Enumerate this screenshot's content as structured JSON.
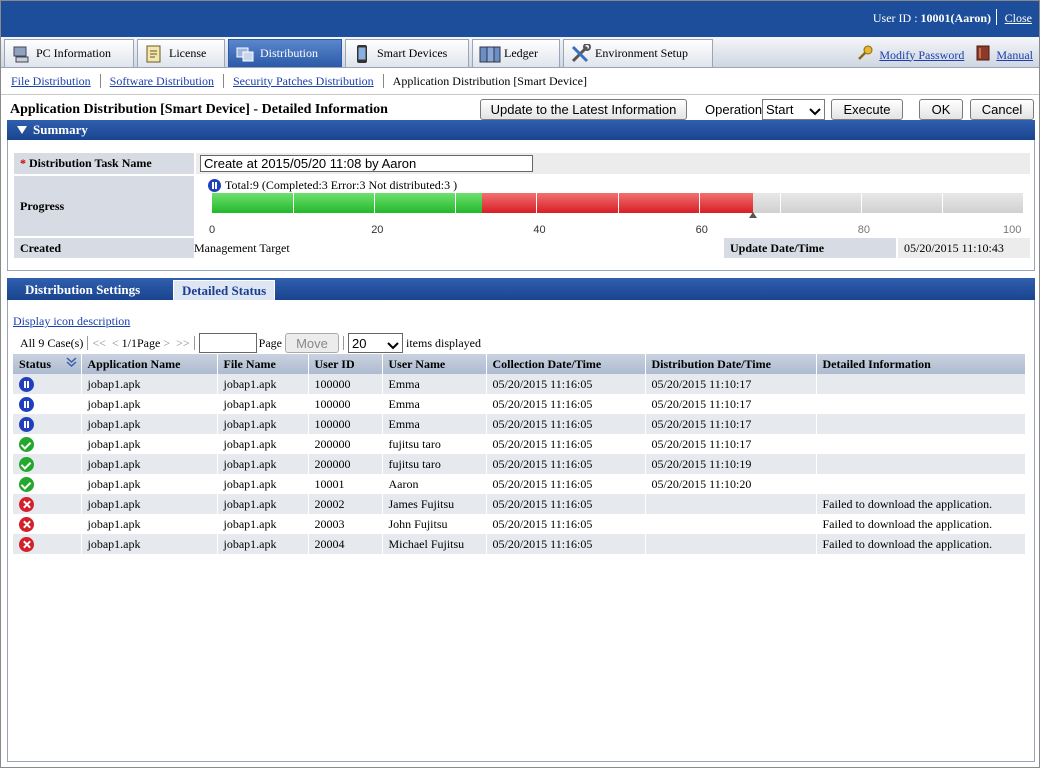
{
  "header": {
    "user_id_label": "User ID :",
    "user_id_value": "10001(Aaron)",
    "close_label": "Close"
  },
  "menu": {
    "tabs": [
      {
        "label": "PC Information",
        "icon": "pc-icon"
      },
      {
        "label": "License",
        "icon": "license-icon"
      },
      {
        "label": "Distribution",
        "icon": "distribution-icon",
        "active": true
      },
      {
        "label": "Smart Devices",
        "icon": "smartphone-icon"
      },
      {
        "label": "Ledger",
        "icon": "ledger-icon"
      },
      {
        "label": "Environment Setup",
        "icon": "tools-icon"
      }
    ],
    "modify_password": "Modify Password",
    "manual": "Manual"
  },
  "breadcrumb": {
    "items": [
      "File Distribution",
      "Software Distribution",
      "Security Patches Distribution"
    ],
    "current": "Application Distribution [Smart Device]"
  },
  "toolbar": {
    "title": "Application Distribution [Smart Device] - Detailed Information",
    "update_label": "Update to the Latest Information",
    "operation_label": "Operation:",
    "operation_value": "Start",
    "execute_label": "Execute",
    "ok_label": "OK",
    "cancel_label": "Cancel"
  },
  "summary": {
    "heading": "Summary",
    "task_name_label": "Distribution Task Name",
    "task_name_value": "Create at 2015/05/20 11:08 by Aaron",
    "progress_label": "Progress",
    "progress_text": "Total:9  (Completed:3  Error:3  Not distributed:3 )",
    "progress": {
      "total": 9,
      "completed": 3,
      "error": 3,
      "not_distributed": 3
    },
    "ticks": [
      "0",
      "20",
      "40",
      "60",
      "80",
      "100"
    ],
    "created_label": "Created",
    "created_value": "Management Target",
    "update_label": "Update Date/Time",
    "update_value": "05/20/2015 11:10:43"
  },
  "detail_tabs": {
    "settings": "Distribution Settings",
    "status": "Detailed Status"
  },
  "detail": {
    "icon_desc_link": "Display icon description",
    "all_cases": "All 9 Case(s)",
    "first": "<<",
    "prev": "<",
    "page_info": "1/1Page",
    "next": ">",
    "last": ">>",
    "page_input_value": "",
    "page_label": "Page",
    "move_label": "Move",
    "per_page": "20",
    "items_displayed": "items displayed"
  },
  "table": {
    "headers": [
      "Status",
      "Application Name",
      "File Name",
      "User ID",
      "User Name",
      "Collection Date/Time",
      "Distribution Date/Time",
      "Detailed Information"
    ],
    "rows": [
      {
        "status": "paused",
        "app": "jobap1.apk",
        "file": "jobap1.apk",
        "uid": "100000",
        "user": "Emma",
        "collected": "05/20/2015 11:16:05",
        "distributed": "05/20/2015 11:10:17",
        "info": ""
      },
      {
        "status": "paused",
        "app": "jobap1.apk",
        "file": "jobap1.apk",
        "uid": "100000",
        "user": "Emma",
        "collected": "05/20/2015 11:16:05",
        "distributed": "05/20/2015 11:10:17",
        "info": ""
      },
      {
        "status": "paused",
        "app": "jobap1.apk",
        "file": "jobap1.apk",
        "uid": "100000",
        "user": "Emma",
        "collected": "05/20/2015 11:16:05",
        "distributed": "05/20/2015 11:10:17",
        "info": ""
      },
      {
        "status": "completed",
        "app": "jobap1.apk",
        "file": "jobap1.apk",
        "uid": "200000",
        "user": "fujitsu taro",
        "collected": "05/20/2015 11:16:05",
        "distributed": "05/20/2015 11:10:17",
        "info": ""
      },
      {
        "status": "completed",
        "app": "jobap1.apk",
        "file": "jobap1.apk",
        "uid": "200000",
        "user": "fujitsu taro",
        "collected": "05/20/2015 11:16:05",
        "distributed": "05/20/2015 11:10:19",
        "info": ""
      },
      {
        "status": "completed",
        "app": "jobap1.apk",
        "file": "jobap1.apk",
        "uid": "10001",
        "user": "Aaron",
        "collected": "05/20/2015 11:16:05",
        "distributed": "05/20/2015 11:10:20",
        "info": ""
      },
      {
        "status": "error",
        "app": "jobap1.apk",
        "file": "jobap1.apk",
        "uid": "20002",
        "user": "James Fujitsu",
        "collected": "05/20/2015 11:16:05",
        "distributed": "",
        "info": "Failed to download the application."
      },
      {
        "status": "error",
        "app": "jobap1.apk",
        "file": "jobap1.apk",
        "uid": "20003",
        "user": "John Fujitsu",
        "collected": "05/20/2015 11:16:05",
        "distributed": "",
        "info": "Failed to download the application."
      },
      {
        "status": "error",
        "app": "jobap1.apk",
        "file": "jobap1.apk",
        "uid": "20004",
        "user": "Michael Fujitsu",
        "collected": "05/20/2015 11:16:05",
        "distributed": "",
        "info": "Failed to download the application."
      }
    ]
  },
  "colors": {
    "brand": "#1d4e9c",
    "completed": "#22b82a",
    "error": "#e0202a",
    "not_distributed": "#d8d8d8",
    "link": "#1a3fae"
  }
}
